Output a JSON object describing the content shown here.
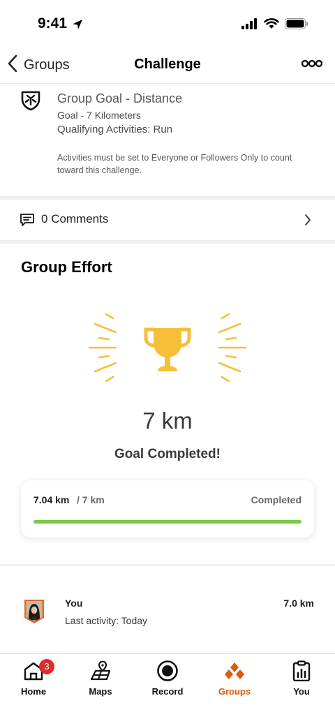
{
  "status_bar": {
    "time": "9:41"
  },
  "nav": {
    "back_label": "Groups",
    "title": "Challenge",
    "more_icon": "more-dots-icon"
  },
  "goal": {
    "title": "Group Goal - Distance",
    "goal_line": "Goal - 7 Kilometers",
    "qualifying": "Qualifying Activities: Run",
    "note": "Activities must be set to Everyone or Followers Only to count toward this challenge."
  },
  "comments": {
    "label": "0 Comments"
  },
  "effort": {
    "heading": "Group Effort",
    "distance": "7 km",
    "status_message": "Goal Completed!",
    "progress": {
      "current": "7.04 km",
      "goal": "/ 7 km",
      "status": "Completed",
      "fraction": 1.0
    }
  },
  "member": {
    "name": "You",
    "activity": "Last activity: Today",
    "distance": "7.0 km"
  },
  "tabs": [
    {
      "label": "Home",
      "icon": "home-icon",
      "badge": "3",
      "active": false
    },
    {
      "label": "Maps",
      "icon": "map-icon",
      "active": false
    },
    {
      "label": "Record",
      "icon": "record-icon",
      "active": false
    },
    {
      "label": "Groups",
      "icon": "groups-icon",
      "active": true
    },
    {
      "label": "You",
      "icon": "clipboard-chart-icon",
      "active": false
    }
  ],
  "colors": {
    "accent": "#e0570f",
    "progress": "#7ac943",
    "trophy": "#f6bf3a",
    "badge": "#e02b2b"
  }
}
